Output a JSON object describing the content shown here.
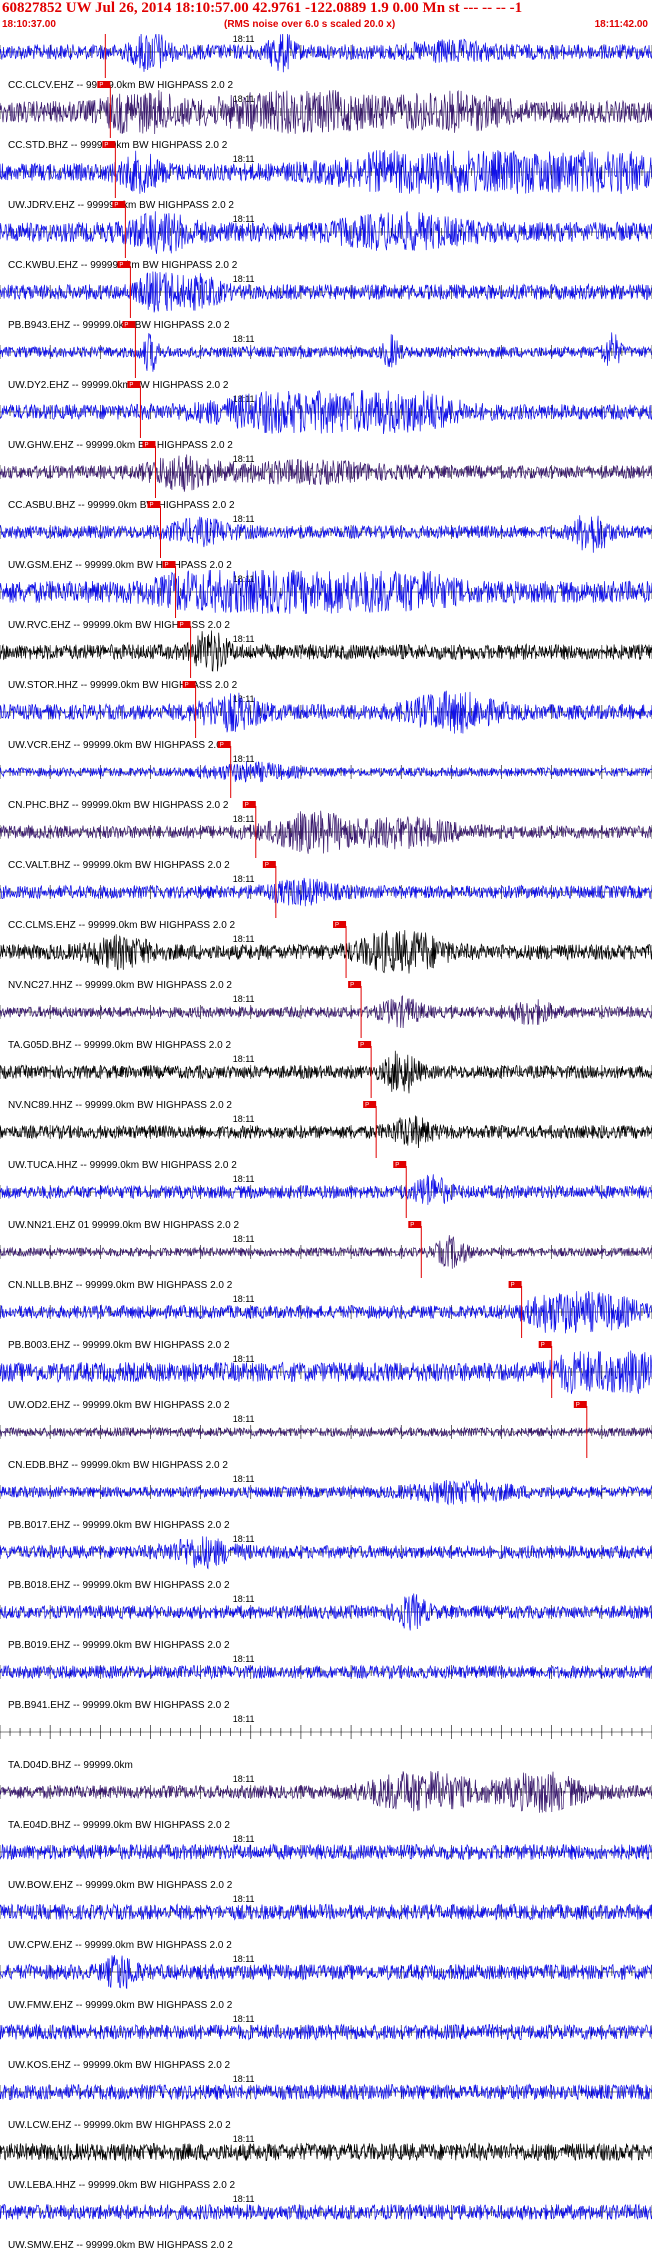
{
  "header": {
    "title": "60827852 UW Jul 26, 2014 18:10:57.00   42.9761 -122.0889  1.9 0.00 Mn st --- -- --  -1",
    "start_time": "18:10:37.00",
    "rms_note": "(RMS noise over 6.0 s scaled 20.0 x)",
    "end_time": "18:11:42.00"
  },
  "colors": {
    "blue": "#1010e8",
    "purple": "#3a1a6e",
    "black": "#000000",
    "pick": "#e00000"
  },
  "chart_data": {
    "type": "line",
    "title": "60827852 UW Jul 26, 2014 18:10:57.00   42.9761 -122.0889  1.9 0.00 Mn st --- -- --  -1",
    "x_range": [
      "18:10:37.00",
      "18:11:42.00"
    ],
    "minute_label": "18:11",
    "pick_label": "P",
    "series": [
      {
        "name": "CC.CLCV.EHZ.--",
        "label": "CC.CLCV.EHZ -- 99999.0km BW  HIGHPASS  2.0  2",
        "color": "blue",
        "amp": 0.35,
        "pick_s": 10.5,
        "events": [
          [
            15,
            0.9,
            1.5
          ],
          [
            28,
            0.9,
            1.0
          ],
          [
            45,
            0.25,
            4
          ]
        ]
      },
      {
        "name": "CC.STD.BHZ.--",
        "label": "CC.STD.BHZ -- 99999.0km BW  HIGHPASS  2.0  2",
        "color": "purple",
        "amp": 0.5,
        "pick_s": 11.0,
        "events": [
          [
            14,
            0.8,
            3
          ],
          [
            30,
            0.6,
            8
          ],
          [
            45,
            0.5,
            5
          ]
        ]
      },
      {
        "name": "UW.JDRV.EHZ.--",
        "label": "UW.JDRV.EHZ -- 99999.0km BW  HIGHPASS  2.0  2",
        "color": "blue",
        "amp": 0.4,
        "pick_s": 11.5,
        "events": [
          [
            14,
            0.6,
            2
          ],
          [
            44,
            1.0,
            9
          ],
          [
            53,
            1.0,
            6
          ],
          [
            62,
            0.6,
            3
          ]
        ]
      },
      {
        "name": "CC.KWBU.EHZ.--",
        "label": "CC.KWBU.EHZ -- 99999.0km BW  HIGHPASS  2.0  2",
        "color": "blue",
        "amp": 0.45,
        "pick_s": 12.5,
        "events": [
          [
            16,
            0.6,
            3
          ],
          [
            40,
            0.5,
            6
          ]
        ]
      },
      {
        "name": "PB.B943.EHZ.--",
        "label": "PB.B943.EHZ -- 99999.0km BW  HIGHPASS  2.0  2",
        "color": "blue",
        "amp": 0.35,
        "pick_s": 13.0,
        "events": [
          [
            16,
            0.8,
            2
          ],
          [
            20,
            0.5,
            2
          ]
        ]
      },
      {
        "name": "UW.DY2.EHZ.--",
        "label": "UW.DY2.EHZ -- 99999.0km BW  HIGHPASS  2.0  2",
        "color": "blue",
        "amp": 0.25,
        "pick_s": 13.5,
        "events": [
          [
            15,
            0.8,
            0.7
          ],
          [
            39,
            0.6,
            0.8
          ],
          [
            61,
            0.7,
            0.8
          ]
        ]
      },
      {
        "name": "UW.GHW.EHZ.--",
        "label": "UW.GHW.EHZ -- 99999.0km BW  HIGHPASS  2.0  2",
        "color": "blue",
        "amp": 0.35,
        "pick_s": 14.0,
        "events": [
          [
            30,
            0.8,
            8
          ],
          [
            40,
            0.8,
            5
          ]
        ]
      },
      {
        "name": "CC.ASBU.BHZ.--",
        "label": "CC.ASBU.BHZ -- 99999.0km BW  HIGHPASS  2.0  2",
        "color": "purple",
        "amp": 0.3,
        "pick_s": 15.5,
        "events": [
          [
            18,
            0.6,
            3
          ],
          [
            30,
            0.3,
            8
          ]
        ]
      },
      {
        "name": "UW.GSM.EHZ.--",
        "label": "UW.GSM.EHZ -- 99999.0km BW  HIGHPASS  2.0  2",
        "color": "blue",
        "amp": 0.3,
        "pick_s": 16.0,
        "events": [
          [
            20,
            0.4,
            3
          ],
          [
            59,
            0.9,
            1.5
          ]
        ]
      },
      {
        "name": "UW.RVC.EHZ.--",
        "label": "UW.RVC.EHZ -- 99999.0km BW  HIGHPASS  2.0  2",
        "color": "blue",
        "amp": 0.5,
        "pick_s": 17.5,
        "events": [
          [
            22,
            1.0,
            5
          ],
          [
            32,
            1.0,
            6
          ],
          [
            40,
            0.9,
            4
          ]
        ]
      },
      {
        "name": "UW.STOR.HHZ.--",
        "label": "UW.STOR.HHZ -- 99999.0km BW  HIGHPASS  2.0  2",
        "color": "black",
        "amp": 0.35,
        "pick_s": 19.0,
        "events": [
          [
            21,
            0.9,
            1.5
          ]
        ]
      },
      {
        "name": "UW.VCR.EHZ.--",
        "label": "UW.VCR.EHZ -- 99999.0km BW  HIGHPASS  2.0  2",
        "color": "blue",
        "amp": 0.35,
        "pick_s": 19.5,
        "events": [
          [
            23,
            0.6,
            3
          ],
          [
            45,
            0.7,
            4
          ]
        ]
      },
      {
        "name": "CN.PHC.BHZ.--",
        "label": "CN.PHC.BHZ -- 99999.0km BW  HIGHPASS  2.0  2",
        "color": "blue",
        "amp": 0.2,
        "pick_s": 23.0,
        "events": [
          [
            25,
            0.3,
            4
          ]
        ]
      },
      {
        "name": "CC.VALT.BHZ.--",
        "label": "CC.VALT.BHZ -- 99999.0km BW  HIGHPASS  2.0  2",
        "color": "purple",
        "amp": 0.3,
        "pick_s": 25.5,
        "events": [
          [
            31,
            0.7,
            4
          ],
          [
            40,
            0.5,
            5
          ]
        ]
      },
      {
        "name": "CC.CLMS.EHZ.--",
        "label": "CC.CLMS.EHZ -- 99999.0km BW  HIGHPASS  2.0  2",
        "color": "blue",
        "amp": 0.3,
        "pick_s": 27.5,
        "events": [
          [
            30,
            0.4,
            3
          ]
        ]
      },
      {
        "name": "NV.NC27.HHZ.--",
        "label": "NV.NC27.HHZ -- 99999.0km BW  HIGHPASS  2.0  2",
        "color": "black",
        "amp": 0.35,
        "pick_s": 34.5,
        "events": [
          [
            40,
            1.0,
            3.5
          ],
          [
            12,
            0.5,
            3
          ]
        ]
      },
      {
        "name": "TA.G05D.BHZ.--",
        "label": "TA.G05D.BHZ -- 99999.0km BW  HIGHPASS  2.0  2",
        "color": "purple",
        "amp": 0.25,
        "pick_s": 36.0,
        "events": [
          [
            40,
            0.5,
            2
          ],
          [
            53,
            0.4,
            2
          ]
        ]
      },
      {
        "name": "NV.NC89.HHZ.--",
        "label": "NV.NC89.HHZ -- 99999.0km BW  HIGHPASS  2.0  2",
        "color": "black",
        "amp": 0.3,
        "pick_s": 37.0,
        "events": [
          [
            40,
            0.9,
            1.5
          ]
        ]
      },
      {
        "name": "UW.TUCA.HHZ.--",
        "label": "UW.TUCA.HHZ -- 99999.0km BW  HIGHPASS  2.0  2",
        "color": "black",
        "amp": 0.3,
        "pick_s": 37.5,
        "events": [
          [
            41,
            0.5,
            2
          ]
        ]
      },
      {
        "name": "UW.NN21.EHZ.01",
        "label": "UW.NN21.EHZ 01 99999.0km BW  HIGHPASS  2.0  2",
        "color": "blue",
        "amp": 0.3,
        "pick_s": 40.5,
        "events": [
          [
            43,
            0.6,
            1.5
          ]
        ]
      },
      {
        "name": "CN.NLLB.BHZ.--",
        "label": "CN.NLLB.BHZ -- 99999.0km BW  HIGHPASS  2.0  2",
        "color": "purple",
        "amp": 0.2,
        "pick_s": 42.0,
        "events": [
          [
            45,
            0.6,
            1.5
          ]
        ]
      },
      {
        "name": "PB.B003.EHZ.--",
        "label": "PB.B003.EHZ -- 99999.0km BW  HIGHPASS  2.0  2",
        "color": "blue",
        "amp": 0.3,
        "pick_s": 52.0,
        "events": [
          [
            56,
            0.9,
            3
          ],
          [
            61,
            0.5,
            3
          ]
        ]
      },
      {
        "name": "UW.OD2.EHZ.--",
        "label": "UW.OD2.EHZ -- 99999.0km BW  HIGHPASS  2.0  2",
        "color": "blue",
        "amp": 0.45,
        "pick_s": 55.0,
        "events": [
          [
            59,
            1.0,
            3
          ],
          [
            63,
            0.8,
            2
          ]
        ]
      },
      {
        "name": "CN.EDB.BHZ.--",
        "label": "CN.EDB.BHZ -- 99999.0km BW  HIGHPASS  2.0  2",
        "color": "purple",
        "amp": 0.2,
        "pick_s": 58.5,
        "events": []
      },
      {
        "name": "PB.B017.EHZ.--",
        "label": "PB.B017.EHZ -- 99999.0km BW  HIGHPASS  2.0  2",
        "color": "blue",
        "amp": 0.25,
        "pick_s": null,
        "events": [
          [
            46,
            0.35,
            5
          ]
        ]
      },
      {
        "name": "PB.B018.EHZ.--",
        "label": "PB.B018.EHZ -- 99999.0km BW  HIGHPASS  2.0  2",
        "color": "blue",
        "amp": 0.3,
        "pick_s": null,
        "events": [
          [
            20,
            0.5,
            3
          ]
        ]
      },
      {
        "name": "PB.B019.EHZ.--",
        "label": "PB.B019.EHZ -- 99999.0km BW  HIGHPASS  2.0  2",
        "color": "blue",
        "amp": 0.3,
        "pick_s": null,
        "events": [
          [
            41,
            0.6,
            1.5
          ]
        ]
      },
      {
        "name": "PB.B941.EHZ.--",
        "label": "PB.B941.EHZ -- 99999.0km BW  HIGHPASS  2.0  2",
        "color": "blue",
        "amp": 0.3,
        "pick_s": null,
        "events": []
      },
      {
        "name": "TA.D04D.BHZ.--",
        "label": "TA.D04D.BHZ -- 99999.0km",
        "color": "blue",
        "amp": 0.0,
        "pick_s": null,
        "events": []
      },
      {
        "name": "TA.E04D.BHZ.--",
        "label": "TA.E04D.BHZ -- 99999.0km BW  HIGHPASS  2.0  2",
        "color": "purple",
        "amp": 0.3,
        "pick_s": null,
        "events": [
          [
            42,
            0.8,
            5
          ],
          [
            54,
            0.7,
            4
          ]
        ]
      },
      {
        "name": "UW.BOW.EHZ.--",
        "label": "UW.BOW.EHZ -- 99999.0km BW  HIGHPASS  2.0  2",
        "color": "blue",
        "amp": 0.35,
        "pick_s": null,
        "events": []
      },
      {
        "name": "UW.CPW.EHZ.--",
        "label": "UW.CPW.EHZ -- 99999.0km BW  HIGHPASS  2.0  2",
        "color": "blue",
        "amp": 0.35,
        "pick_s": null,
        "events": []
      },
      {
        "name": "UW.FMW.EHZ.--",
        "label": "UW.FMW.EHZ -- 99999.0km BW  HIGHPASS  2.0  2",
        "color": "blue",
        "amp": 0.35,
        "pick_s": null,
        "events": [
          [
            12,
            0.6,
            1.5
          ]
        ]
      },
      {
        "name": "UW.KOS.EHZ.--",
        "label": "UW.KOS.EHZ -- 99999.0km BW  HIGHPASS  2.0  2",
        "color": "blue",
        "amp": 0.35,
        "pick_s": null,
        "events": []
      },
      {
        "name": "UW.LCW.EHZ.--",
        "label": "UW.LCW.EHZ -- 99999.0km BW  HIGHPASS  2.0  2",
        "color": "blue",
        "amp": 0.35,
        "pick_s": null,
        "events": []
      },
      {
        "name": "UW.LEBA.HHZ.--",
        "label": "UW.LEBA.HHZ -- 99999.0km BW  HIGHPASS  2.0  2",
        "color": "black",
        "amp": 0.4,
        "pick_s": null,
        "events": []
      },
      {
        "name": "UW.SMW.EHZ.--",
        "label": "UW.SMW.EHZ -- 99999.0km BW  HIGHPASS  2.0  2",
        "color": "blue",
        "amp": 0.35,
        "pick_s": null,
        "events": []
      }
    ]
  }
}
